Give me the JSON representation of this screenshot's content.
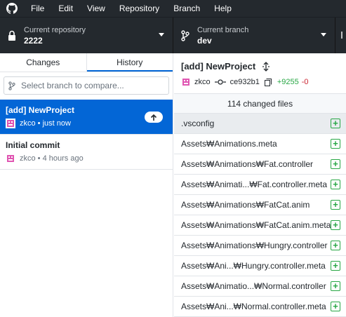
{
  "menu": [
    "File",
    "Edit",
    "View",
    "Repository",
    "Branch",
    "Help"
  ],
  "toolbar": {
    "repo_label": "Current repository",
    "repo_value": "2222",
    "branch_label": "Current branch",
    "branch_value": "dev"
  },
  "sidebar": {
    "tabs": [
      {
        "label": "Changes",
        "active": false
      },
      {
        "label": "History",
        "active": true
      }
    ],
    "filter_placeholder": "Select branch to compare...",
    "commits": [
      {
        "title": "[add] NewProject",
        "author": "zkco",
        "time": "just now",
        "selected": true,
        "unpushed": true
      },
      {
        "title": "Initial commit",
        "author": "zkco",
        "time": "4 hours ago",
        "selected": false,
        "unpushed": false
      }
    ]
  },
  "commit_detail": {
    "title": "[add] NewProject",
    "author": "zkco",
    "sha": "ce932b1",
    "additions": "+9255",
    "deletions": "-0",
    "changed_files_text": "114 changed files"
  },
  "files": [
    {
      "name": ".vsconfig",
      "status": "added"
    },
    {
      "name": "Assets₩Animations.meta",
      "status": "added"
    },
    {
      "name": "Assets₩Animations₩Fat.controller",
      "status": "added"
    },
    {
      "name": "Assets₩Animati...₩Fat.controller.meta",
      "status": "added"
    },
    {
      "name": "Assets₩Animations₩FatCat.anim",
      "status": "added"
    },
    {
      "name": "Assets₩Animations₩FatCat.anim.meta",
      "status": "added"
    },
    {
      "name": "Assets₩Animations₩Hungry.controller",
      "status": "added"
    },
    {
      "name": "Assets₩Ani...₩Hungry.controller.meta",
      "status": "added"
    },
    {
      "name": "Assets₩Animatio...₩Normal.controller",
      "status": "added"
    },
    {
      "name": "Assets₩Ani...₩Normal.controller.meta",
      "status": "added"
    }
  ],
  "colors": {
    "chrome": "#24292e",
    "accent": "#0366d6",
    "added": "#28a745",
    "deleted": "#cb2431",
    "avatar": "#e056b2"
  },
  "icons": {
    "app": "github-icon",
    "repo": "lock-icon",
    "branch": "git-branch-icon",
    "push": "arrow-up-icon",
    "commit": "git-commit-icon",
    "copy": "copy-icon",
    "expand": "unfold-icon",
    "file_status": "diff-added-icon"
  }
}
